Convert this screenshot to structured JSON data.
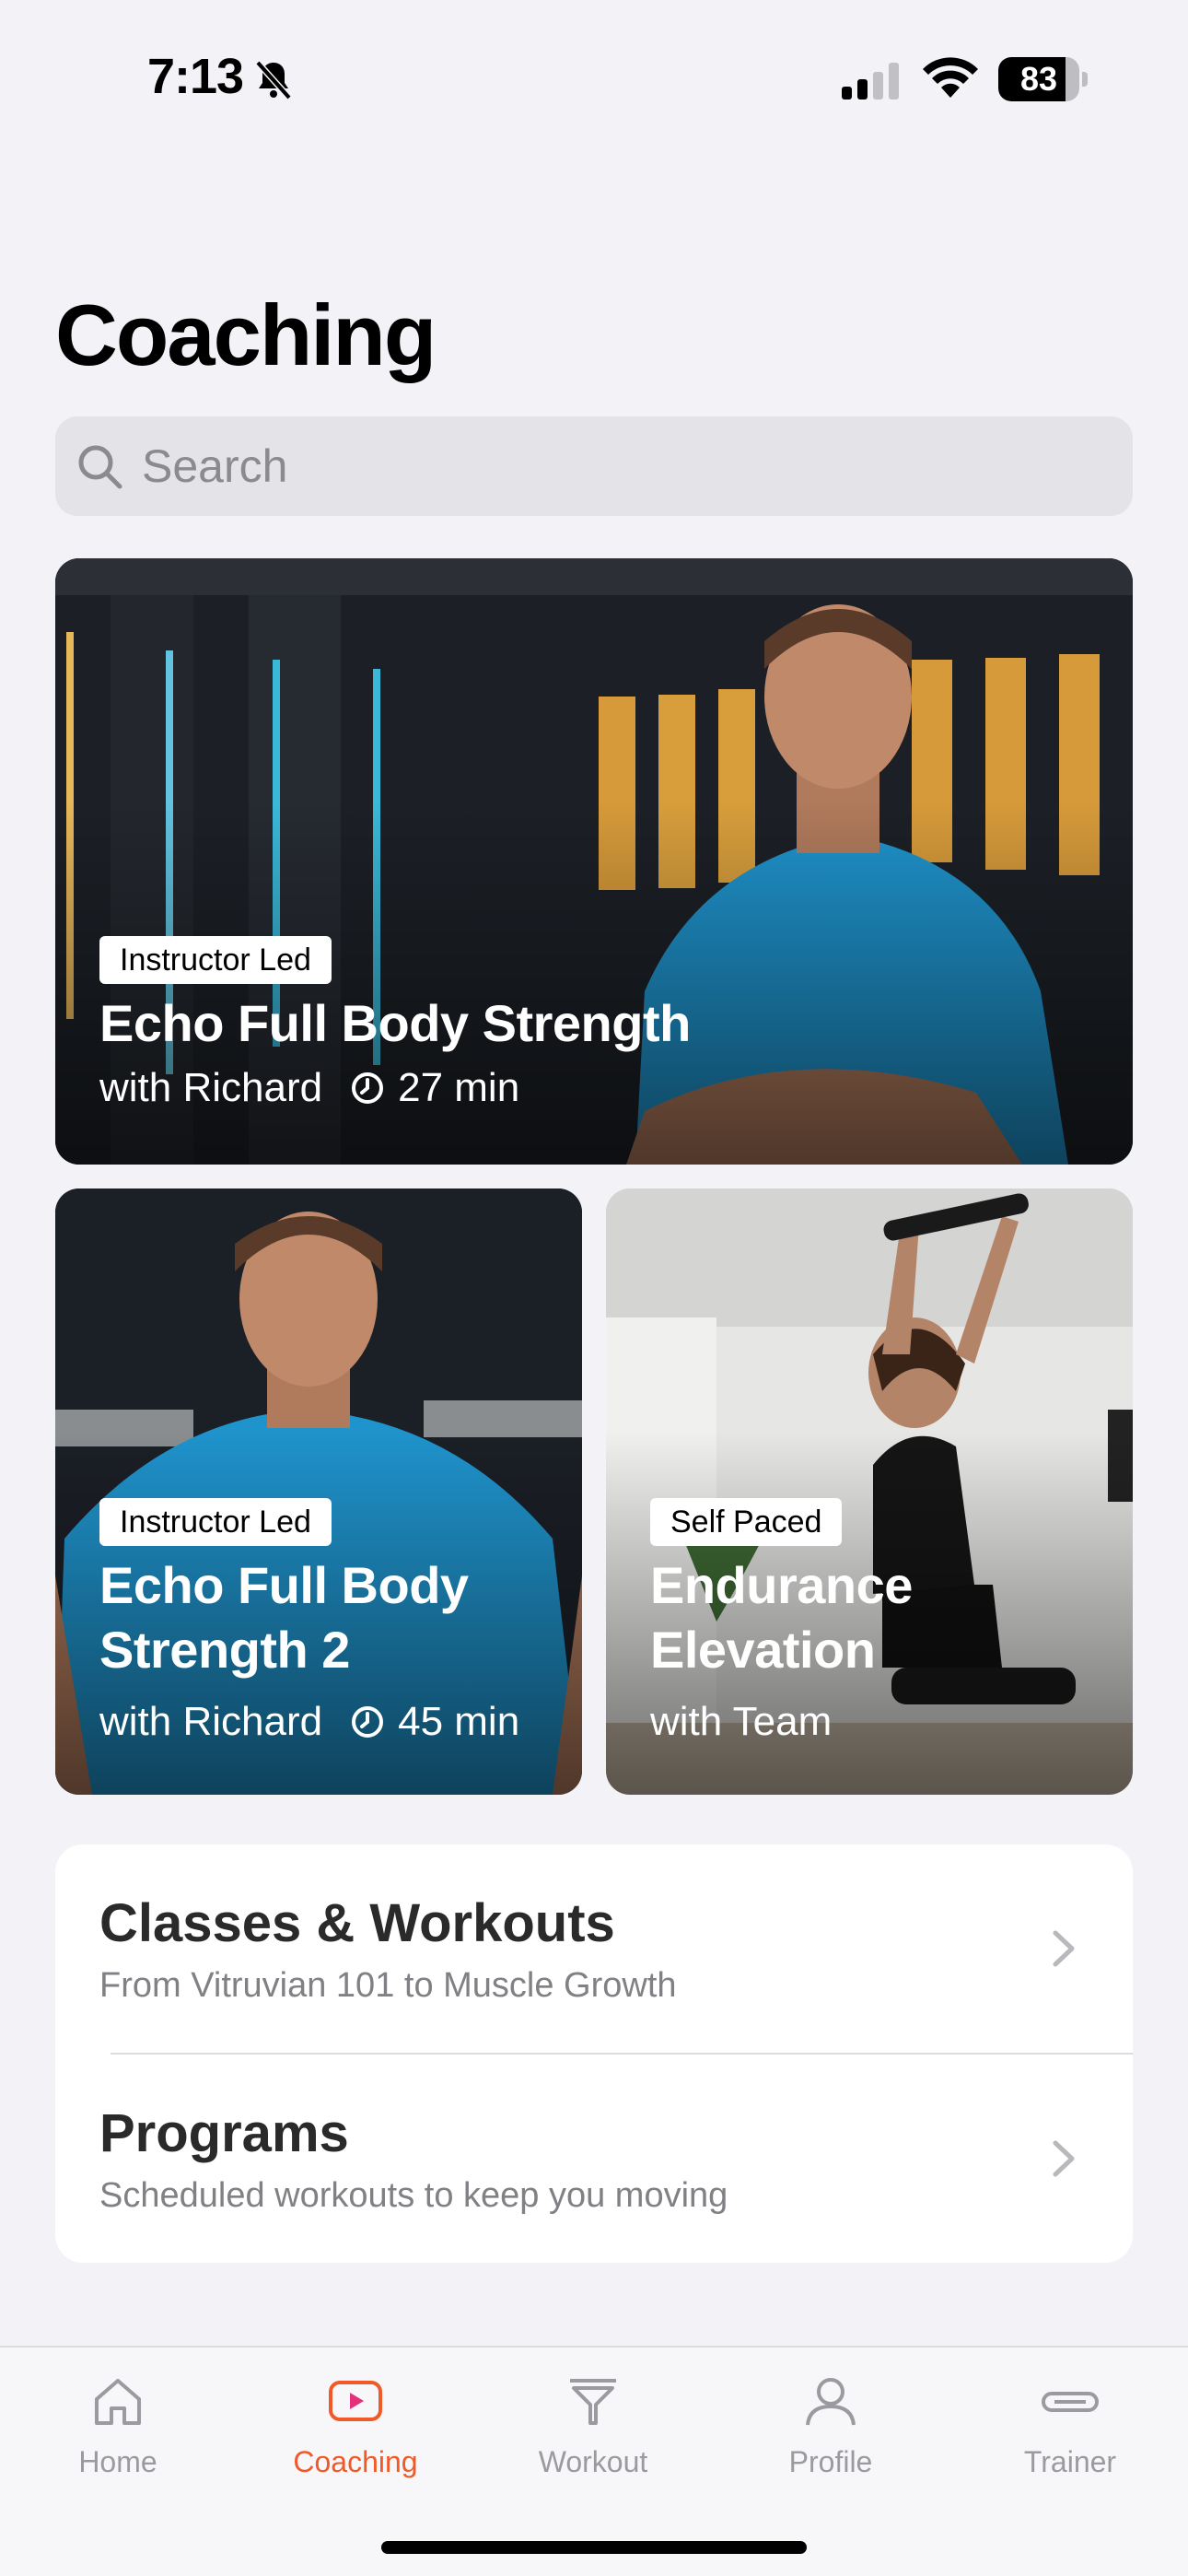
{
  "status": {
    "time": "7:13",
    "battery": "83",
    "battery_fraction": 0.83
  },
  "title": "Coaching",
  "search": {
    "placeholder": "Search"
  },
  "featured": {
    "badge": "Instructor Led",
    "title": "Echo Full Body Strength",
    "instructor": "with Richard",
    "duration": "27 min"
  },
  "cards": [
    {
      "badge": "Instructor Led",
      "title_line1": "Echo Full Body",
      "title_line2": "Strength 2",
      "instructor": "with Richard",
      "duration": "45 min"
    },
    {
      "badge": "Self Paced",
      "title_line1": "Endurance",
      "title_line2": "Elevation",
      "instructor": "with Team"
    }
  ],
  "menu": [
    {
      "title": "Classes & Workouts",
      "subtitle": "From Vitruvian 101 to Muscle Growth"
    },
    {
      "title": "Programs",
      "subtitle": "Scheduled workouts to keep you moving"
    }
  ],
  "tabs": [
    {
      "label": "Home",
      "icon": "home-icon"
    },
    {
      "label": "Coaching",
      "icon": "play-icon"
    },
    {
      "label": "Workout",
      "icon": "funnel-icon"
    },
    {
      "label": "Profile",
      "icon": "person-icon"
    },
    {
      "label": "Trainer",
      "icon": "device-icon"
    }
  ],
  "colors": {
    "accent": "#f05a28",
    "background": "#f2f2f7",
    "inactive_tab": "#9a9aa0"
  }
}
